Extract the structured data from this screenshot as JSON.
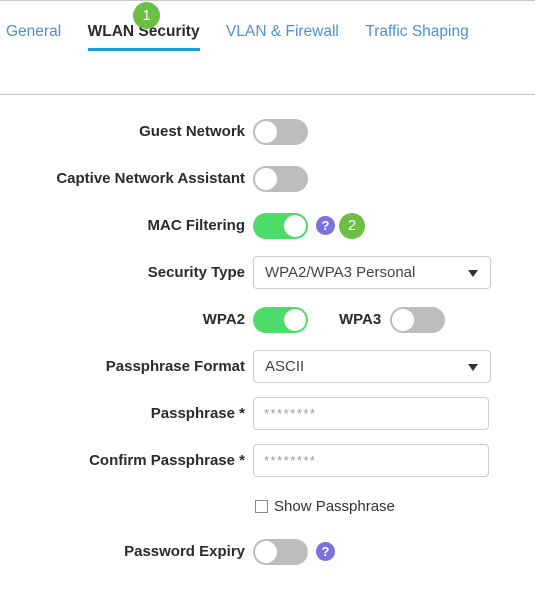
{
  "tabs": [
    {
      "label": "General",
      "active": false
    },
    {
      "label": "WLAN Security",
      "active": true
    },
    {
      "label": "VLAN & Firewall",
      "active": false
    },
    {
      "label": "Traffic Shaping",
      "active": false
    }
  ],
  "badges": {
    "step1": "1",
    "step2": "2"
  },
  "icons": {
    "help": "?",
    "caret": "chevron-down-icon"
  },
  "form": {
    "guest_network": {
      "label": "Guest Network",
      "state": "off"
    },
    "captive_network_assistant": {
      "label": "Captive Network Assistant",
      "state": "off"
    },
    "mac_filtering": {
      "label": "MAC Filtering",
      "state": "on"
    },
    "security_type": {
      "label": "Security Type",
      "value": "WPA2/WPA3 Personal"
    },
    "wpa2": {
      "label": "WPA2",
      "state": "on"
    },
    "wpa3": {
      "label": "WPA3",
      "state": "off"
    },
    "passphrase_format": {
      "label": "Passphrase Format",
      "value": "ASCII"
    },
    "passphrase": {
      "label": "Passphrase",
      "required_marker": "*",
      "value": "",
      "placeholder": "********"
    },
    "confirm_passphrase": {
      "label": "Confirm Passphrase",
      "required_marker": "*",
      "value": "",
      "placeholder": "********"
    },
    "show_passphrase": {
      "label": "Show Passphrase",
      "checked": false
    },
    "password_expiry": {
      "label": "Password Expiry",
      "state": "off"
    }
  },
  "colors": {
    "tab_link": "#4a90d9",
    "tab_active_underline": "#1aa0d8",
    "toggle_on": "#4ddb6a",
    "toggle_off": "#bdbdbd",
    "badge_green": "#6cbe45",
    "help_purple": "#7b72e0"
  }
}
